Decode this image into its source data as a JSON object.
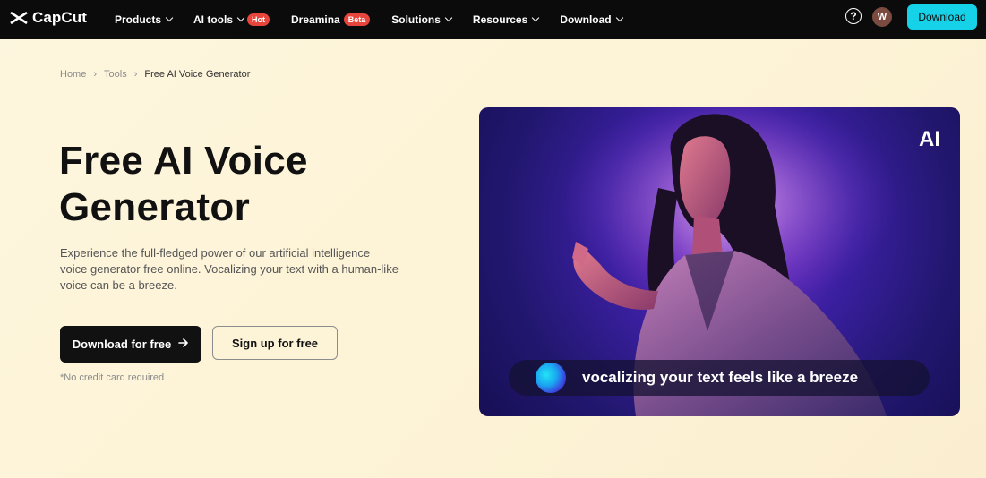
{
  "nav": {
    "logo_text": "CapCut",
    "items": [
      {
        "label": "Products",
        "has_dropdown": true,
        "badge": ""
      },
      {
        "label": "AI tools",
        "has_dropdown": true,
        "badge": "Hot"
      },
      {
        "label": "Dreamina",
        "has_dropdown": false,
        "badge": "Beta"
      },
      {
        "label": "Solutions",
        "has_dropdown": true,
        "badge": ""
      },
      {
        "label": "Resources",
        "has_dropdown": true,
        "badge": ""
      },
      {
        "label": "Download",
        "has_dropdown": true,
        "badge": ""
      }
    ],
    "help_icon": "question-circle-icon",
    "avatar_initial": "W",
    "download_label": "Download"
  },
  "breadcrumb": {
    "items": [
      "Home",
      "Tools",
      "Free AI Voice Generator"
    ],
    "separator": "›"
  },
  "hero": {
    "title": "Free AI Voice Generator",
    "description": "Experience the full-fledged power of our artificial intelligence voice generator free online. Vocalizing your text with a human-like voice can be a breeze.",
    "primary_button": "Download for free",
    "secondary_button": "Sign up for free",
    "note": "*No credit card required"
  },
  "media": {
    "ai_label": "AI",
    "caption": "vocalizing your text feels like a breeze"
  },
  "colors": {
    "nav_bg": "#0b0b0c",
    "accent": "#16d2e8",
    "badge": "#e8453c",
    "page_bg": "#fdf6de"
  }
}
